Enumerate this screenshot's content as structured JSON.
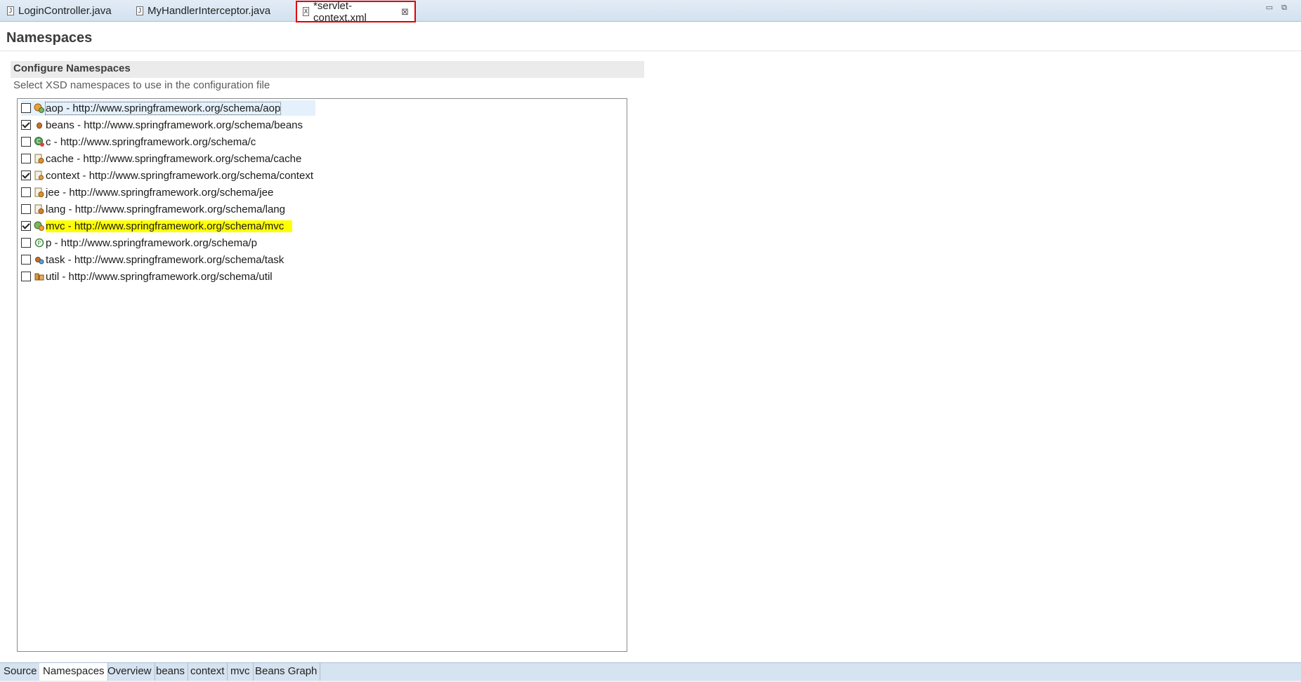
{
  "editor_tabs": [
    {
      "label": "LoginController.java",
      "icon": "java-file-icon",
      "active": false
    },
    {
      "label": "MyHandlerInterceptor.java",
      "icon": "java-file-icon",
      "active": false
    },
    {
      "label": "*servlet-context.xml",
      "icon": "xml-file-icon",
      "active": true,
      "close_icon": "close-icon"
    }
  ],
  "window_controls": {
    "minimize_glyph": "▭",
    "restore_glyph": "⧉"
  },
  "page": {
    "title": "Namespaces",
    "section_title": "Configure Namespaces",
    "section_description": "Select XSD namespaces to use in the configuration file"
  },
  "namespaces": [
    {
      "label": "aop - http://www.springframework.org/schema/aop",
      "checked": false,
      "icon": "aop-icon"
    },
    {
      "label": "beans - http://www.springframework.org/schema/beans",
      "checked": true,
      "icon": "beans-icon"
    },
    {
      "label": "c - http://www.springframework.org/schema/c",
      "checked": false,
      "icon": "c-namespace-icon"
    },
    {
      "label": "cache - http://www.springframework.org/schema/cache",
      "checked": false,
      "icon": "cache-icon"
    },
    {
      "label": "context - http://www.springframework.org/schema/context",
      "checked": true,
      "icon": "context-icon"
    },
    {
      "label": "jee - http://www.springframework.org/schema/jee",
      "checked": false,
      "icon": "jee-icon"
    },
    {
      "label": "lang - http://www.springframework.org/schema/lang",
      "checked": false,
      "icon": "lang-icon"
    },
    {
      "label": "mvc - http://www.springframework.org/schema/mvc",
      "checked": true,
      "icon": "mvc-icon"
    },
    {
      "label": "p - http://www.springframework.org/schema/p",
      "checked": false,
      "icon": "p-namespace-icon"
    },
    {
      "label": "task - http://www.springframework.org/schema/task",
      "checked": false,
      "icon": "task-icon"
    },
    {
      "label": "util - http://www.springframework.org/schema/util",
      "checked": false,
      "icon": "util-icon"
    }
  ],
  "bottom_tabs": [
    {
      "label": "Source",
      "active": false
    },
    {
      "label": "Namespaces",
      "active": true
    },
    {
      "label": "Overview",
      "active": false
    },
    {
      "label": "beans",
      "active": false
    },
    {
      "label": "context",
      "active": false
    },
    {
      "label": "mvc",
      "active": false
    },
    {
      "label": "Beans Graph",
      "active": false
    }
  ],
  "colors": {
    "highlight": "#ffff00",
    "active_tab_outline": "#e00000",
    "tabbar_background": "#d6e3f0"
  }
}
